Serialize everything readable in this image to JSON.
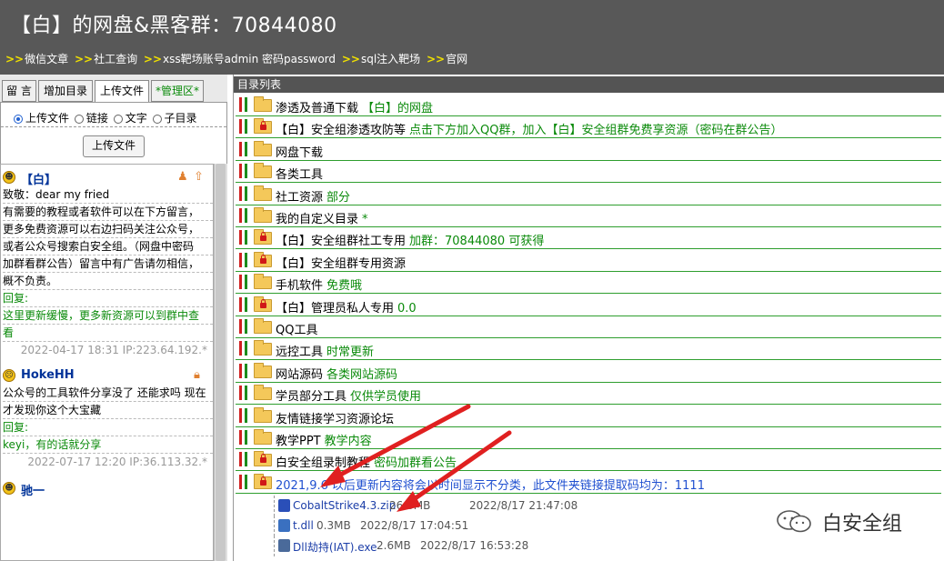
{
  "header": {
    "title": "【白】的网盘&黑客群：70844080",
    "nav_links": [
      "微信文章",
      "社工查询",
      "xss靶场账号admin 密码password",
      "sql注入靶场",
      "官网"
    ],
    "nav_arrow": ">>"
  },
  "left": {
    "tabs": [
      "留 言",
      "增加目录",
      "上传文件",
      "*管理区*"
    ],
    "active_tab": "上传文件",
    "radio_options": [
      "上传文件",
      "链接",
      "文字",
      "子目录"
    ],
    "radio_selected": "上传文件",
    "upload_button": "上传文件",
    "messages": [
      {
        "user": "【白】",
        "lines": [
          "致敬：dear my fried",
          "有需要的教程或者软件可以在下方留言，",
          "更多免费资源可以右边扫码关注公众号，",
          "或者公众号搜索白安全组。（网盘中密码",
          "加群看群公告）留言中有广告请勿相信，",
          "概不负责。"
        ],
        "reply_label": "回复:",
        "reply_lines": [
          "这里更新缓慢，更多新资源可以到群中查",
          "看"
        ],
        "meta": "2022-04-17 18:31 IP:223.64.192.*"
      },
      {
        "user": "HokeHH",
        "lines": [
          "公众号的工具软件分享没了 还能求吗 现在",
          "才发现你这个大宝藏"
        ],
        "reply_label": "回复:",
        "reply_lines": [
          "keyi，有的话就分享"
        ],
        "meta": "2022-07-17 12:20 IP:36.113.32.*"
      },
      {
        "user": "驰一",
        "lines": [],
        "reply_label": "",
        "reply_lines": [],
        "meta": ""
      }
    ]
  },
  "right": {
    "header": "目录列表",
    "rows": [
      {
        "name": "渗透及普通下载",
        "note": "【白】的网盘",
        "locked": false
      },
      {
        "name": "【白】安全组渗透攻防等",
        "note": "点击下方加入QQ群，加入【白】安全组群免费享资源（密码在群公告）",
        "locked": true
      },
      {
        "name": "网盘下载",
        "note": "",
        "locked": false
      },
      {
        "name": "各类工具",
        "note": "",
        "locked": false
      },
      {
        "name": "社工资源",
        "note": "部分",
        "locked": false
      },
      {
        "name": "我的自定义目录",
        "note": "*",
        "locked": false
      },
      {
        "name": "【白】安全组群社工专用",
        "note": "加群：70844080 可获得",
        "locked": true
      },
      {
        "name": "【白】安全组群专用资源",
        "note": "",
        "locked": true
      },
      {
        "name": "手机软件",
        "note": "免费哦",
        "locked": false
      },
      {
        "name": "【白】管理员私人专用",
        "note": "0.0",
        "locked": true
      },
      {
        "name": "QQ工具",
        "note": "",
        "locked": false
      },
      {
        "name": "远控工具",
        "note": "时常更新",
        "locked": false
      },
      {
        "name": "网站源码",
        "note": "各类网站源码",
        "locked": false
      },
      {
        "name": "学员部分工具",
        "note": "仅供学员使用",
        "locked": false
      },
      {
        "name": "友情链接学习资源论坛",
        "note": "",
        "locked": false
      },
      {
        "name": "教学PPT",
        "note": "教学内容",
        "locked": false
      },
      {
        "name": "白安全组录制教程",
        "note": "密码加群看公告",
        "locked": true
      },
      {
        "name": "2021,9.6",
        "note": "以后更新内容将会以时间显示不分类，此文件夹链接提取码均为：1111",
        "locked": true
      }
    ],
    "files": [
      {
        "name": "CobaltStrike4.3.zip",
        "size": "26.6MB",
        "date": "2022/8/17 21:47:08",
        "icon": "archive-icon"
      },
      {
        "name": "t.dll",
        "size": "0.3MB",
        "date": "2022/8/17 17:04:51",
        "icon": "dll-icon"
      },
      {
        "name": "Dll劫持(IAT).exe",
        "size": "2.6MB",
        "date": "2022/8/17 16:53:28",
        "icon": "exe-icon"
      }
    ]
  },
  "watermark": "白安全组",
  "colors": {
    "header_bg": "#585858",
    "note_green": "#0a8a0a",
    "annotation_red": "#e02020"
  }
}
